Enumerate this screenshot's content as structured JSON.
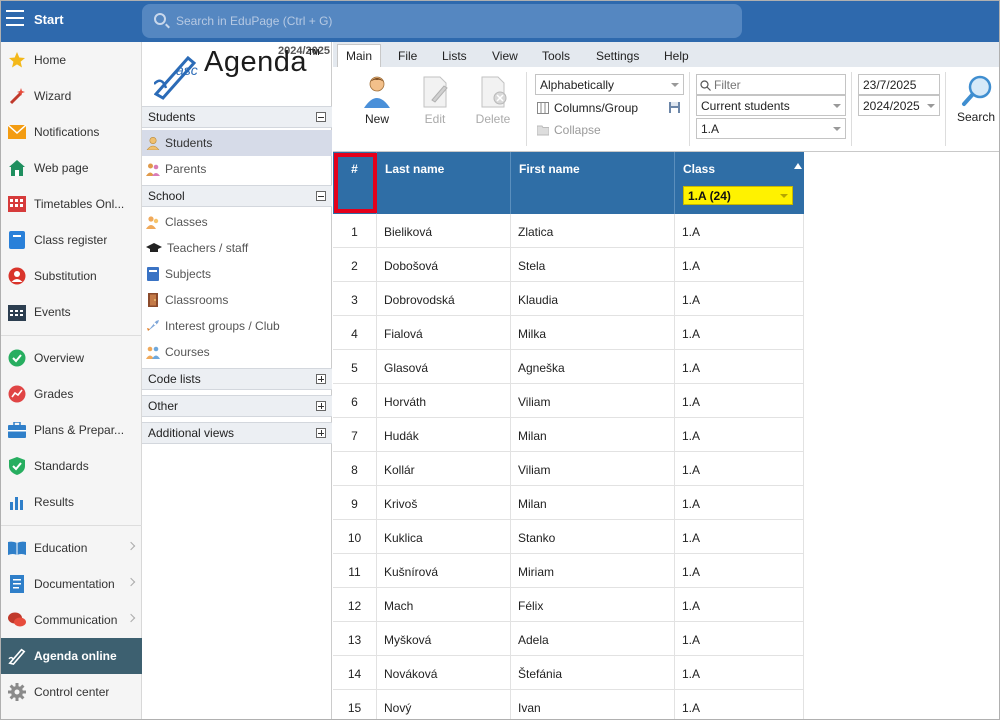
{
  "topbar": {
    "start_label": "Start",
    "search_placeholder": "Search in EduPage (Ctrl + G)"
  },
  "leftnav": {
    "items": [
      {
        "label": "Home",
        "icon": "star-icon"
      },
      {
        "label": "Wizard",
        "icon": "magic-wand-icon"
      },
      {
        "label": "Notifications",
        "icon": "envelope-icon"
      },
      {
        "label": "Web page",
        "icon": "house-icon"
      },
      {
        "label": "Timetables Onl...",
        "icon": "timetable-grid-icon"
      },
      {
        "label": "Class register",
        "icon": "class-register-icon"
      },
      {
        "label": "Substitution",
        "icon": "substitution-person-icon"
      },
      {
        "label": "Events",
        "icon": "calendar-icon"
      },
      {
        "label": "Overview",
        "icon": "check-circle-icon"
      },
      {
        "label": "Grades",
        "icon": "grades-chart-icon"
      },
      {
        "label": "Plans & Prepar...",
        "icon": "briefcase-icon"
      },
      {
        "label": "Standards",
        "icon": "shield-check-icon"
      },
      {
        "label": "Results",
        "icon": "bar-chart-icon"
      },
      {
        "label": "Education",
        "icon": "open-book-icon"
      },
      {
        "label": "Documentation",
        "icon": "document-icon"
      },
      {
        "label": "Communication",
        "icon": "chat-bubbles-icon"
      },
      {
        "label": "Agenda online",
        "icon": "agenda-pen-icon"
      },
      {
        "label": "Control center",
        "icon": "gear-icon"
      }
    ]
  },
  "panel": {
    "year": "2024/2025",
    "logo_prefix": "asc",
    "logo_name": "Agenda",
    "logo_tm": "TM",
    "sections": {
      "students": "Students",
      "school": "School",
      "code_lists": "Code lists",
      "other": "Other",
      "additional_views": "Additional views"
    },
    "students_items": [
      "Students",
      "Parents"
    ],
    "school_items": [
      "Classes",
      "Teachers / staff",
      "Subjects",
      "Classrooms",
      "Interest groups / Club",
      "Courses"
    ]
  },
  "ribbon": {
    "menu": [
      "Main",
      "File",
      "Lists",
      "View",
      "Tools",
      "Settings",
      "Help"
    ],
    "new_label": "New",
    "edit_label": "Edit",
    "delete_label": "Delete",
    "sort_value": "Alphabetically",
    "columns_label": "Columns/Group",
    "collapse_label": "Collapse",
    "filter_placeholder": "Filter",
    "students_filter_value": "Current students",
    "class_value": "1.A",
    "date_value": "23/7/2025",
    "year_value": "2024/2025",
    "search_label": "Search"
  },
  "table": {
    "headers": {
      "num": "#",
      "last_name": "Last name",
      "first_name": "First name",
      "class": "Class"
    },
    "class_filter": "1.A (24)",
    "rows": [
      {
        "num": "1",
        "last": "Bieliková",
        "first": "Zlatica",
        "class": "1.A"
      },
      {
        "num": "2",
        "last": "Dobošová",
        "first": "Stela",
        "class": "1.A"
      },
      {
        "num": "3",
        "last": "Dobrovodská",
        "first": "Klaudia",
        "class": "1.A"
      },
      {
        "num": "4",
        "last": "Fialová",
        "first": "Milka",
        "class": "1.A"
      },
      {
        "num": "5",
        "last": "Glasová",
        "first": "Agneška",
        "class": "1.A"
      },
      {
        "num": "6",
        "last": "Horváth",
        "first": "Viliam",
        "class": "1.A"
      },
      {
        "num": "7",
        "last": "Hudák",
        "first": "Milan",
        "class": "1.A"
      },
      {
        "num": "8",
        "last": "Kollár",
        "first": "Viliam",
        "class": "1.A"
      },
      {
        "num": "9",
        "last": "Krivoš",
        "first": "Milan",
        "class": "1.A"
      },
      {
        "num": "10",
        "last": "Kuklica",
        "first": "Stanko",
        "class": "1.A"
      },
      {
        "num": "11",
        "last": "Kušnírová",
        "first": "Miriam",
        "class": "1.A"
      },
      {
        "num": "12",
        "last": "Mach",
        "first": "Félix",
        "class": "1.A"
      },
      {
        "num": "13",
        "last": "Myšková",
        "first": "Adela",
        "class": "1.A"
      },
      {
        "num": "14",
        "last": "Nováková",
        "first": "Štefánia",
        "class": "1.A"
      },
      {
        "num": "15",
        "last": "Nový",
        "first": "Ivan",
        "class": "1.A"
      }
    ]
  }
}
